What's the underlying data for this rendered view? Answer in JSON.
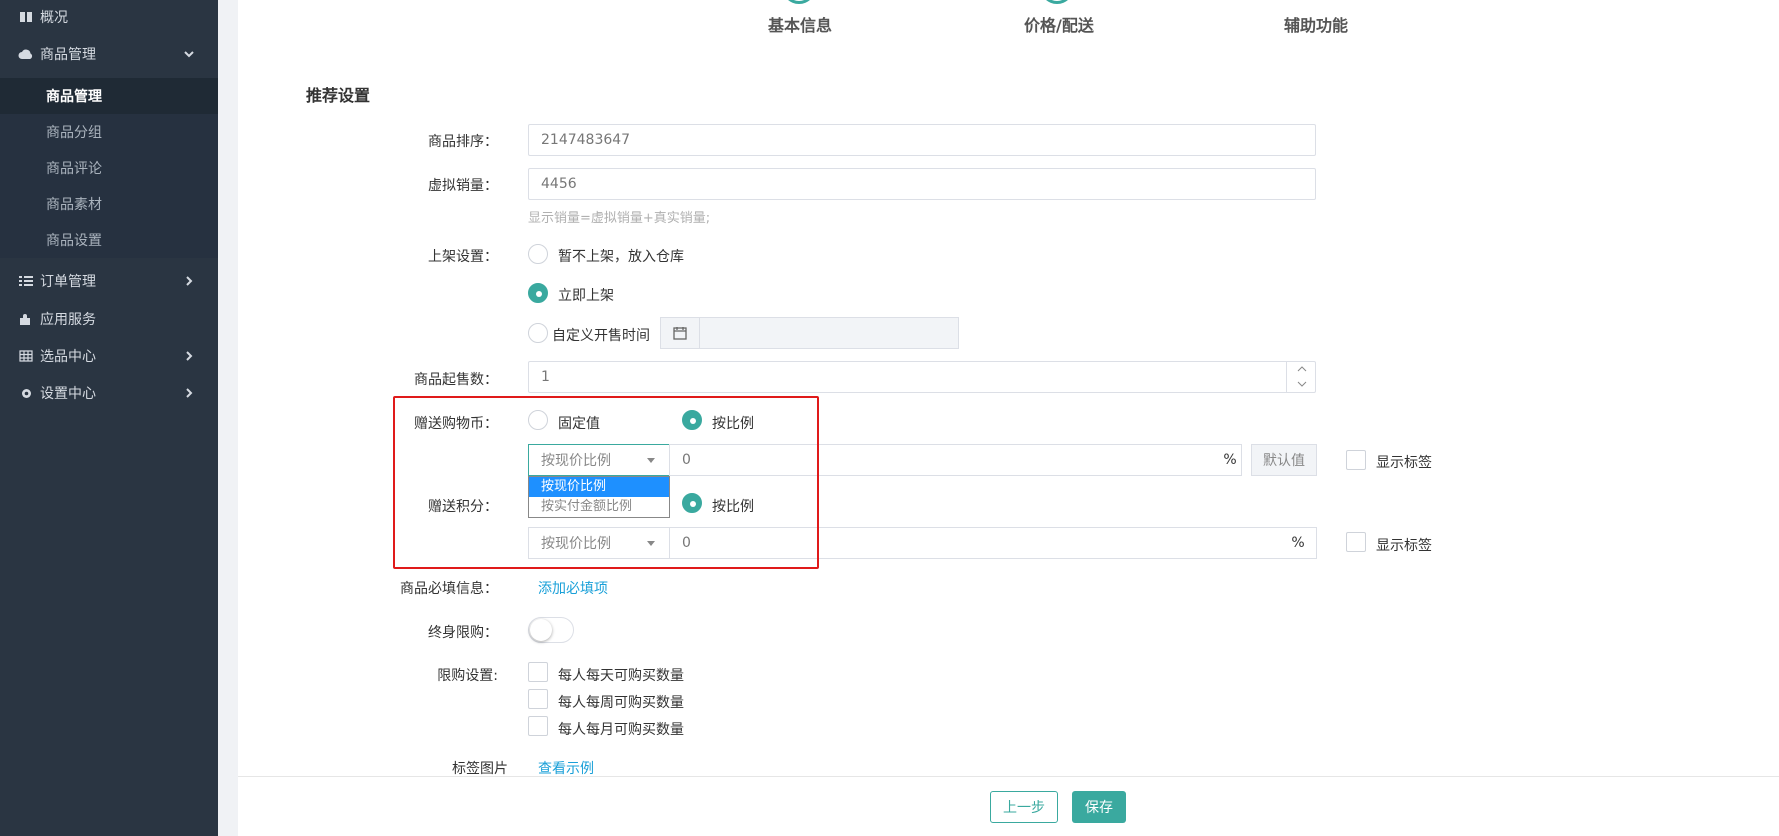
{
  "sidebar": {
    "items": [
      {
        "label": "概况",
        "icon": "book-icon"
      },
      {
        "label": "商品管理",
        "icon": "cloud-icon",
        "expanded": true
      },
      {
        "label": "订单管理",
        "icon": "list-icon"
      },
      {
        "label": "应用服务",
        "icon": "puzzle-icon"
      },
      {
        "label": "选品中心",
        "icon": "grid-icon"
      },
      {
        "label": "设置中心",
        "icon": "gear-icon"
      }
    ],
    "subitems": [
      {
        "label": "商品管理",
        "active": true
      },
      {
        "label": "商品分组"
      },
      {
        "label": "商品评论"
      },
      {
        "label": "商品素材"
      },
      {
        "label": "商品设置"
      }
    ]
  },
  "steps": [
    "基本信息",
    "价格/配送",
    "辅助功能"
  ],
  "section_title": "推荐设置",
  "form": {
    "sort": {
      "label": "商品排序：",
      "value": "2147483647"
    },
    "virtual_sales": {
      "label": "虚拟销量：",
      "value": "4456",
      "hint": "显示销量=虚拟销量+真实销量;"
    },
    "listing": {
      "label": "上架设置：",
      "options": [
        "暂不上架，放入仓库",
        "立即上架",
        "自定义开售时间"
      ],
      "selected": "立即上架"
    },
    "min_qty": {
      "label": "商品起售数：",
      "value": "1"
    },
    "gift_coin": {
      "label": "赠送购物币：",
      "options": [
        "固定值",
        "按比例"
      ],
      "selected": "按比例",
      "select_value": "按现价比例",
      "input_value": "0",
      "unit": "%",
      "default_btn": "默认值",
      "show_tag": "显示标签"
    },
    "dropdown": {
      "options": [
        "按现价比例",
        "按实付金额比例"
      ],
      "highlighted": "按现价比例"
    },
    "gift_points": {
      "label": "赠送积分：",
      "selected_text": "按比例",
      "select_value": "按现价比例",
      "input_value": "0",
      "unit": "%",
      "show_tag": "显示标签"
    },
    "required_info": {
      "label": "商品必填信息：",
      "link": "添加必填项"
    },
    "lifetime_limit": {
      "label": "终身限购：",
      "on": false
    },
    "purchase_limit": {
      "label": "限购设置:",
      "options": [
        "每人每天可购买数量",
        "每人每周可购买数量",
        "每人每月可购买数量"
      ]
    },
    "tag_image": {
      "label": "标签图片",
      "link": "查看示例"
    }
  },
  "footer": {
    "prev": "上一步",
    "save": "保存"
  },
  "colors": {
    "accent": "#3aa99f",
    "sidebar": "#2a3542",
    "highlight": "#e01a1a",
    "link": "#1aa0d8"
  }
}
